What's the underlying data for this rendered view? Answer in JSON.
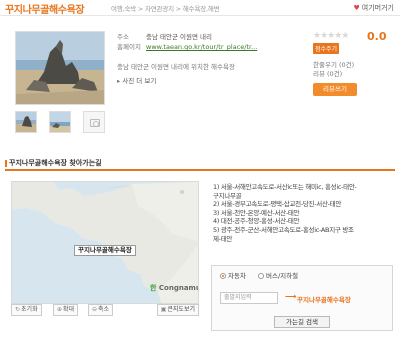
{
  "header": {
    "title": "꾸지나무골해수욕장",
    "breadcrumb": [
      "여행,숙박",
      "자연관광지",
      "해수욕장,해변"
    ],
    "breadcrumb_sep": ">",
    "favorite_label": "여기머거기"
  },
  "info": {
    "address_label": "주소",
    "address_value": "충남 태안군 이원면 내리",
    "homepage_label": "홈페이지",
    "homepage_value": "www.taean.go.kr/tour/tr_place/tr...",
    "description": "충남 태안군 이원면 내리에 위치한 해수욕장",
    "more_label": "사진 더 보기",
    "more_arrow": "▸"
  },
  "rating": {
    "stars": "★★★★★",
    "score": "0.0",
    "badge": "점수주기",
    "recommend_label": "한줄우기 (0건)",
    "review_label": "리뷰 (0건)",
    "review_button": "리뷰쓰기"
  },
  "directions": {
    "title": "꾸지나무골해수욕장 찾아가는길"
  },
  "map": {
    "place_label": "꾸지나무골해수욕장",
    "logo_text": "Congnamul",
    "logo_prefix": "한",
    "reset": "초기화",
    "zoom_in": "확대",
    "zoom_out": "축소",
    "big_map": "큰지도보기"
  },
  "routes": [
    "1) 서울-서해안고속도로-서산ic또는 해미ic, 홍성ic-태안-",
    "구지나무골",
    "2) 서울-경부고속도로-평택-삽교천-당진-서산-태안",
    "3) 서울-천안-온양-예산-서산-태안",
    "4) 대전-공주-청양-홍성-서산-태안",
    "5) 광주-전주-군산-서해안고속도로-홍성ic-AB지구 방조",
    "제-태안"
  ],
  "search": {
    "mode_car": "자동차",
    "mode_walk": "버스/지하철",
    "start_placeholder": "출발지입력",
    "arrow": "⟶",
    "destination": "꾸지나무골해수욕장",
    "go_button": "가는길 검색"
  },
  "colors": {
    "accent": "#e8741c",
    "link": "#3a7a26"
  }
}
